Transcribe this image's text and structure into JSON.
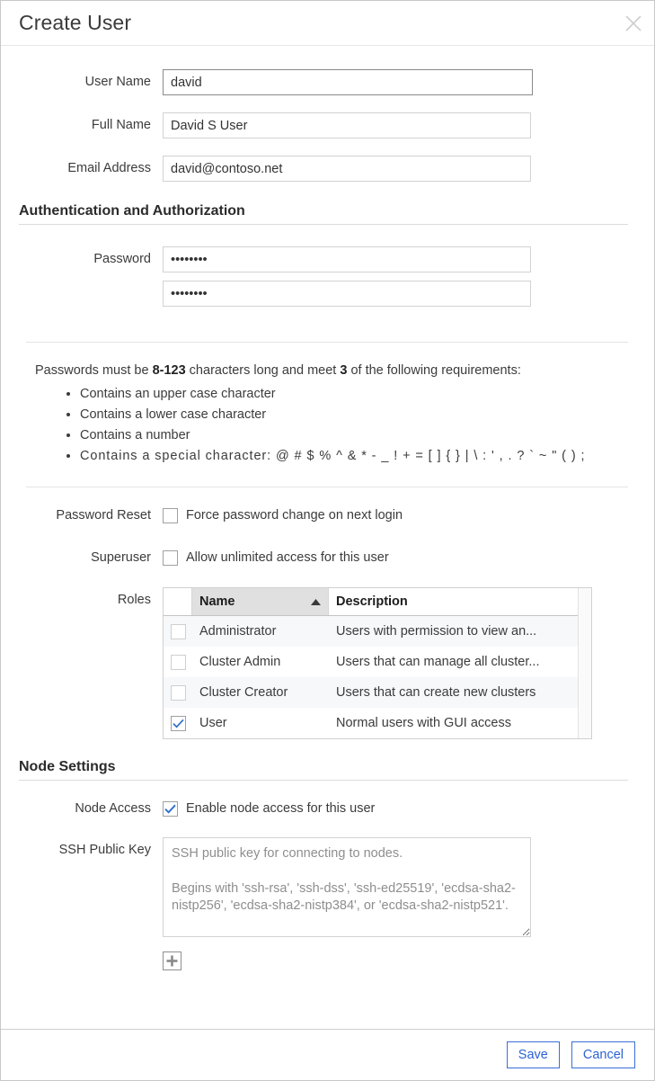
{
  "dialog": {
    "title": "Create User",
    "close_icon": "close-icon"
  },
  "fields": {
    "user_name": {
      "label": "User Name",
      "value": "david",
      "placeholder": ""
    },
    "full_name": {
      "label": "Full Name",
      "value": "David S User",
      "placeholder": ""
    },
    "email_address": {
      "label": "Email Address",
      "value": "david@contoso.net",
      "placeholder": ""
    }
  },
  "auth_section": {
    "heading": "Authentication and Authorization",
    "password_label": "Password",
    "password_value": "••••••••",
    "password_confirm_value": "••••••••",
    "requirements": {
      "intro_prefix": "Passwords must be ",
      "intro_length": "8-123",
      "intro_middle": " characters long and meet ",
      "intro_count": "3",
      "intro_suffix": " of the following requirements:",
      "items": [
        "Contains an upper case character",
        "Contains a lower case character",
        "Contains a number",
        "Contains a special character: @ # $ % ^ & * - _ ! + = [ ] { } | \\ : ' , . ? ` ~ \" ( ) ;"
      ]
    },
    "password_reset": {
      "label": "Password Reset",
      "checkbox_label": "Force password change on next login",
      "checked": false
    },
    "superuser": {
      "label": "Superuser",
      "checkbox_label": "Allow unlimited access for this user",
      "checked": false
    },
    "roles": {
      "label": "Roles",
      "columns": {
        "check": "",
        "name": "Name",
        "description": "Description"
      },
      "sort_column": "Name",
      "sort_direction": "ascending",
      "rows": [
        {
          "checked": false,
          "name": "Administrator",
          "description": "Users with permission to view an..."
        },
        {
          "checked": false,
          "name": "Cluster Admin",
          "description": "Users that can manage all cluster..."
        },
        {
          "checked": false,
          "name": "Cluster Creator",
          "description": "Users that can create new clusters"
        },
        {
          "checked": true,
          "name": "User",
          "description": "Normal users with GUI access"
        }
      ]
    }
  },
  "node_section": {
    "heading": "Node Settings",
    "node_access": {
      "label": "Node Access",
      "checkbox_label": "Enable node access for this user",
      "checked": true
    },
    "ssh_public_key": {
      "label": "SSH Public Key",
      "value": "",
      "placeholder": "SSH public key for connecting to nodes.\n\nBegins with 'ssh-rsa', 'ssh-dss', 'ssh-ed25519', 'ecdsa-sha2-nistp256', 'ecdsa-sha2-nistp384', or 'ecdsa-sha2-nistp521'."
    },
    "add_button": {
      "icon": "plus-icon",
      "label": ""
    }
  },
  "footer": {
    "save_label": "Save",
    "cancel_label": "Cancel"
  },
  "colors": {
    "accent_blue": "#2c62d4",
    "check_blue": "#2b6fd0",
    "border": "#d2d2d2",
    "header_sorted_bg": "#e0e0e0",
    "row_alt_bg": "#f7f8fa"
  }
}
